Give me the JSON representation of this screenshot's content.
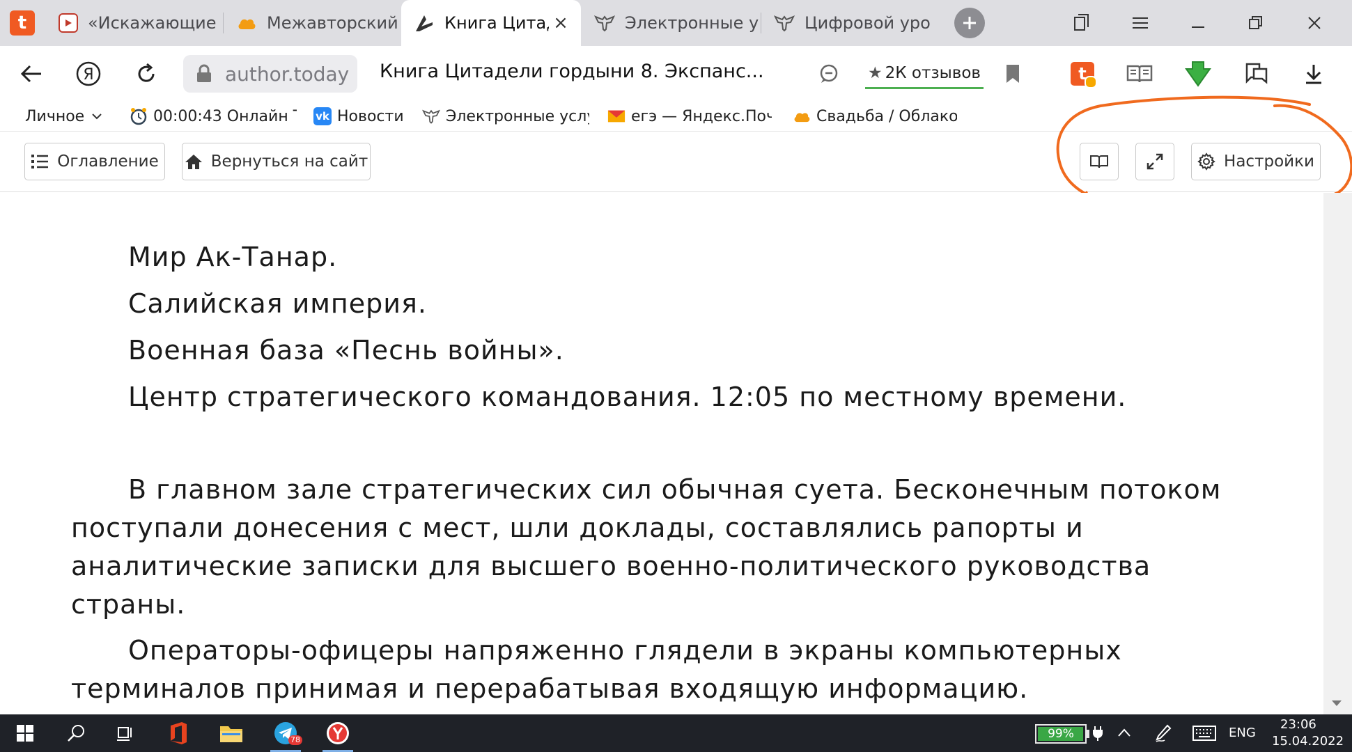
{
  "tabs": [
    {
      "label": "«Искажающие",
      "active": false
    },
    {
      "label": "Межавторский",
      "active": false
    },
    {
      "label": "Книга Цитад",
      "active": true
    },
    {
      "label": "Электронные у",
      "active": false
    },
    {
      "label": "Цифровой уро",
      "active": false
    }
  ],
  "address": {
    "domain": "author.today",
    "page_title": "Книга Цитадели гордыни 8. Экспанс...",
    "reviews_label": "2К отзывов"
  },
  "bookmarks": [
    {
      "label": "Личное",
      "icon": "chevron-down-icon"
    },
    {
      "label": "00:00:43 Онлайн Т",
      "icon": "clock-icon"
    },
    {
      "label": "Новости",
      "icon": "vk-icon"
    },
    {
      "label": "Электронные услу",
      "icon": "eagle-icon"
    },
    {
      "label": "егэ — Яндекс.Поч",
      "icon": "mail-icon"
    },
    {
      "label": "Свадьба / Облако",
      "icon": "cloud-icon"
    }
  ],
  "reader": {
    "toc_label": "Оглавление",
    "back_label": "Вернуться на сайт",
    "settings_label": "Настройки"
  },
  "content": {
    "lines": [
      "Мир Ак-Танар.",
      "Салийская империя.",
      "Военная база «Песнь войны».",
      "Центр стратегического командования. 12:05 по местному времени."
    ],
    "paragraph1": "В главном зале стратегических сил обычная суета. Бесконечным потоком поступали донесения с мест, шли доклады, составлялись рапорты и аналитические записки для высшего военно-политического руководства страны.",
    "paragraph2": "Операторы-офицеры напряженно глядели в экраны компьютерных терминалов принимая и перерабатывая входящую информацию."
  },
  "taskbar": {
    "telegram_badge": "78",
    "battery_percent": 99,
    "battery_label": "99%",
    "language": "ENG",
    "time": "23:06",
    "date": "15.04.2022"
  },
  "colors": {
    "annotation": "#f06a1e",
    "author_today": "#f05a22",
    "battery": "#3aa745"
  }
}
